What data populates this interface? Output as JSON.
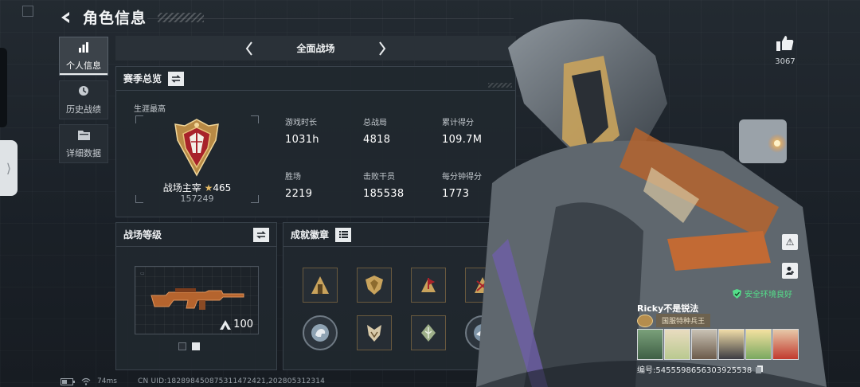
{
  "page": {
    "title": "角色信息"
  },
  "nav": {
    "items": [
      {
        "label": "个人信息",
        "icon": "bar-chart-icon",
        "active": true
      },
      {
        "label": "历史战绩",
        "icon": "clock-icon",
        "active": false
      },
      {
        "label": "详细数据",
        "icon": "folder-icon",
        "active": false
      }
    ]
  },
  "mode": {
    "title": "全面战场"
  },
  "season": {
    "title": "赛季总览",
    "career_label": "生涯最高",
    "rank_name": "战场主宰",
    "rank_stars": "465",
    "rank_points": "157249",
    "stats": [
      {
        "label": "游戏时长",
        "value": "1031h"
      },
      {
        "label": "总战局",
        "value": "4818"
      },
      {
        "label": "累计得分",
        "value": "109.7M"
      },
      {
        "label": "胜场",
        "value": "2219"
      },
      {
        "label": "击败干员",
        "value": "185538"
      },
      {
        "label": "每分钟得分",
        "value": "1773"
      }
    ]
  },
  "battle_level": {
    "title": "战场等级",
    "weapon_level": "100",
    "pager_total": 2,
    "pager_active": 2
  },
  "achievements": {
    "title": "成就徽章",
    "badges": [
      {
        "icon": "gold-tower-badge-icon"
      },
      {
        "icon": "gold-shield-badge-icon"
      },
      {
        "icon": "gold-flag-badge-icon"
      },
      {
        "icon": "gold-crossed-rifles-badge-icon"
      },
      {
        "icon": "dinosaur-round-badge-icon"
      },
      {
        "icon": "fox-badge-icon"
      },
      {
        "icon": "leaf-badge-icon"
      },
      {
        "icon": "shark-round-badge-icon"
      }
    ]
  },
  "footer": {
    "ping": "74ms",
    "uid": "CN UID:182898450875311472421,202805312314"
  },
  "profile": {
    "likes": "3067",
    "env_status": "安全环境良好",
    "player_name": "Ricky不是锐法",
    "player_title": "国服特种兵王",
    "player_id": "编号:5455598656303925538"
  },
  "colors": {
    "accent_gold": "#c9a35c",
    "env_green": "#54e08a",
    "rank_red": "#a8222a"
  }
}
